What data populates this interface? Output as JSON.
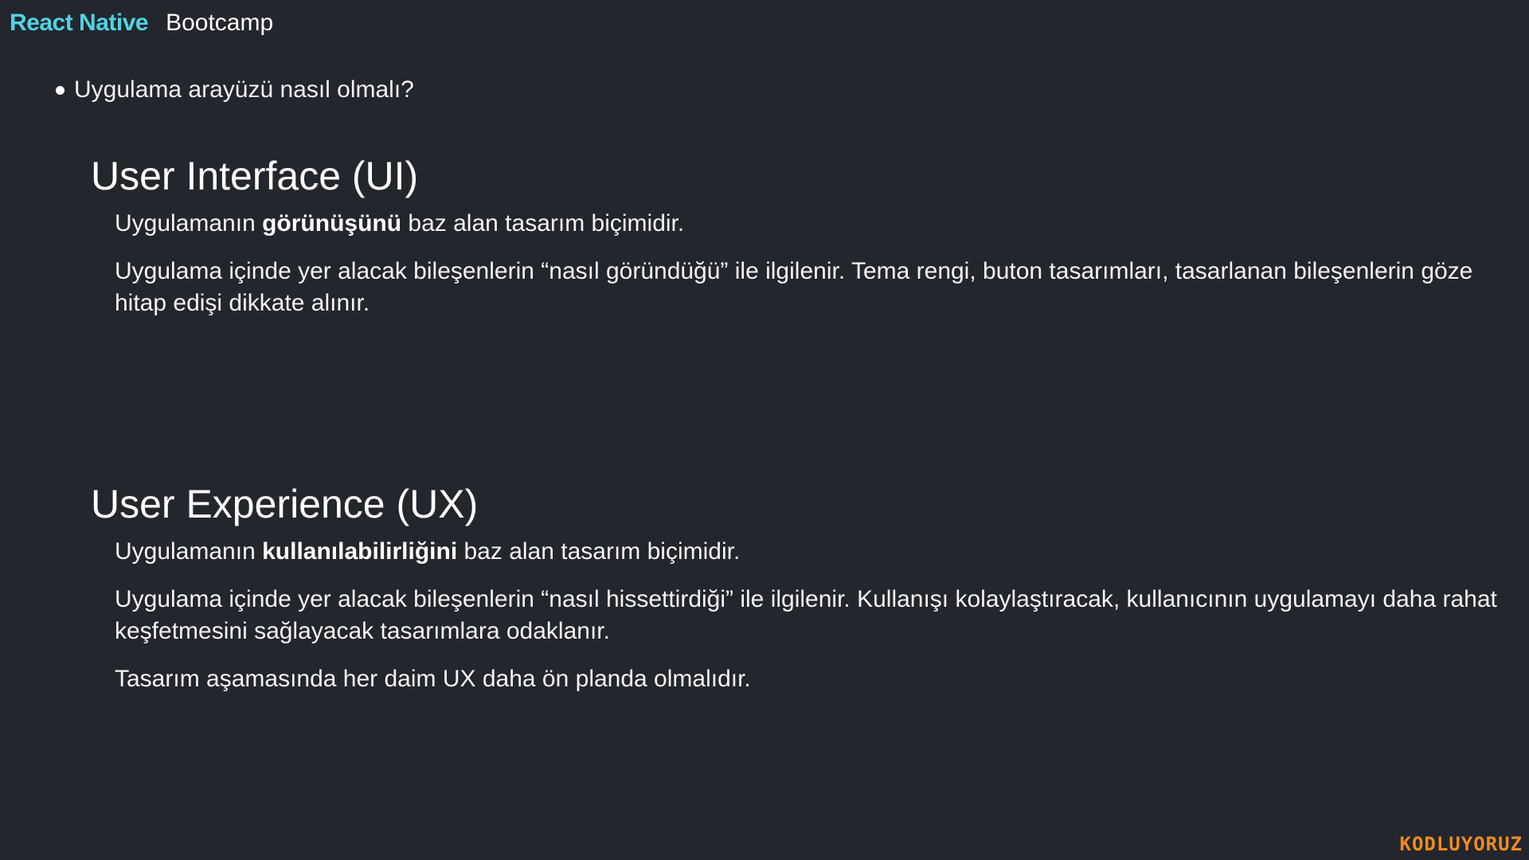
{
  "header": {
    "brand": "React Native",
    "course": "Bootcamp"
  },
  "bullet": {
    "text": "Uygulama arayüzü nasıl olmalı?"
  },
  "ui_section": {
    "title": "User Interface (UI)",
    "p1_prefix": "Uygulamanın ",
    "p1_bold": "görünüşünü",
    "p1_suffix": " baz alan tasarım biçimidir.",
    "p2": "Uygulama içinde yer alacak bileşenlerin “nasıl göründüğü” ile ilgilenir. Tema rengi, buton tasarımları, tasarlanan bileşenlerin göze hitap edişi dikkate alınır."
  },
  "ux_section": {
    "title": "User Experience (UX)",
    "p1_prefix": "Uygulamanın ",
    "p1_bold": "kullanılabilirliğini",
    "p1_suffix": " baz alan tasarım biçimidir.",
    "p2": "Uygulama içinde yer alacak bileşenlerin “nasıl hissettirdiği” ile ilgilenir. Kullanışı kolaylaştıracak, kullanıcının uygulamayı daha rahat keşfetmesini sağlayacak tasarımlara odaklanır.",
    "p3": "Tasarım aşamasında her daim UX daha ön planda olmalıdır."
  },
  "logo": {
    "text": "KODLUYORUZ"
  },
  "colors": {
    "background": "#23262d",
    "brand": "#4fd3e4",
    "logo": "#f08b1f"
  }
}
